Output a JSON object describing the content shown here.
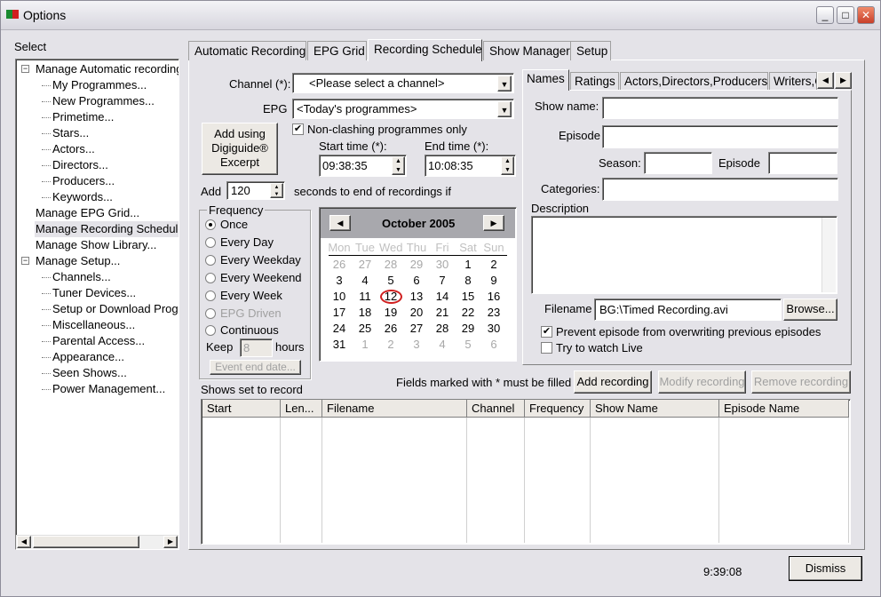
{
  "window": {
    "title": "Options",
    "icon": "app-icon",
    "buttons": [
      "minimize",
      "maximize",
      "close"
    ]
  },
  "sidebar": {
    "label": "Select",
    "items": [
      {
        "label": "Manage Automatic recording",
        "level": 0,
        "expander": "minus"
      },
      {
        "label": "My Programmes...",
        "level": 1
      },
      {
        "label": "New Programmes...",
        "level": 1
      },
      {
        "label": "Primetime...",
        "level": 1
      },
      {
        "label": "Stars...",
        "level": 1
      },
      {
        "label": "Actors...",
        "level": 1
      },
      {
        "label": "Directors...",
        "level": 1
      },
      {
        "label": "Producers...",
        "level": 1
      },
      {
        "label": "Keywords...",
        "level": 1
      },
      {
        "label": "Manage EPG Grid...",
        "level": 0
      },
      {
        "label": "Manage Recording Schedule",
        "level": 0,
        "selected": true
      },
      {
        "label": "Manage Show Library...",
        "level": 0
      },
      {
        "label": "Manage Setup...",
        "level": 0,
        "expander": "minus"
      },
      {
        "label": "Channels...",
        "level": 1
      },
      {
        "label": "Tuner Devices...",
        "level": 1
      },
      {
        "label": "Setup or Download Program",
        "level": 1
      },
      {
        "label": "Miscellaneous...",
        "level": 1
      },
      {
        "label": "Parental Access...",
        "level": 1
      },
      {
        "label": "Appearance...",
        "level": 1
      },
      {
        "label": "Seen Shows...",
        "level": 1
      },
      {
        "label": "Power Management...",
        "level": 1
      }
    ]
  },
  "tabs": [
    {
      "label": "Automatic Recording"
    },
    {
      "label": "EPG Grid"
    },
    {
      "label": "Recording Schedule",
      "selected": true
    },
    {
      "label": "Show Manager"
    },
    {
      "label": "Setup"
    }
  ],
  "form": {
    "channel_label": "Channel (*):",
    "channel_value": "<Please select a channel>",
    "epg_label": "EPG",
    "epg_value": "<Today's programmes>",
    "digiguide_button": "Add using Digiguide® Excerpt",
    "nonclash_label": "Non-clashing programmes only",
    "nonclash_checked": true,
    "start_label": "Start time (*):",
    "start_value": "09:38:35",
    "end_label": "End time (*):",
    "end_value": "10:08:35",
    "add_label": "Add",
    "add_value": "120",
    "add_suffix": "seconds to end of recordings if",
    "frequency": {
      "label": "Frequency",
      "options": [
        {
          "label": "Once",
          "checked": true
        },
        {
          "label": "Every Day"
        },
        {
          "label": "Every Weekday"
        },
        {
          "label": "Every Weekend"
        },
        {
          "label": "Every Week"
        },
        {
          "label": "EPG Driven",
          "disabled": true
        },
        {
          "label": "Continuous"
        }
      ],
      "keep_label": "Keep",
      "keep_value": "8",
      "hours_label": "hours",
      "event_end_button": "Event end date..."
    }
  },
  "calendar": {
    "month": "October 2005",
    "weekdays": [
      "Mon",
      "Tue",
      "Wed",
      "Thu",
      "Fri",
      "Sat",
      "Sun"
    ],
    "weeks": [
      [
        "26",
        "27",
        "28",
        "29",
        "30",
        "1",
        "2"
      ],
      [
        "3",
        "4",
        "5",
        "6",
        "7",
        "8",
        "9"
      ],
      [
        "10",
        "11",
        "12",
        "13",
        "14",
        "15",
        "16"
      ],
      [
        "17",
        "18",
        "19",
        "20",
        "21",
        "22",
        "23"
      ],
      [
        "24",
        "25",
        "26",
        "27",
        "28",
        "29",
        "30"
      ],
      [
        "31",
        "1",
        "2",
        "3",
        "4",
        "5",
        "6"
      ]
    ],
    "today": "12",
    "circle_color": "#d02020"
  },
  "names": {
    "tabs": [
      {
        "label": "Names",
        "selected": true
      },
      {
        "label": "Ratings"
      },
      {
        "label": "Actors,Directors,Producers"
      },
      {
        "label": "Writers,C"
      }
    ],
    "show_name_label": "Show name:",
    "show_name_value": "",
    "episode_label": "Episode",
    "episode_value": "",
    "season_label": "Season:",
    "season_value": "",
    "episode2_label": "Episode",
    "episode2_value": "",
    "categories_label": "Categories:",
    "categories_value": "",
    "description_label": "Description",
    "description_value": "",
    "filename_label": "Filename",
    "filename_value": "BG:\\Timed Recording.avi",
    "browse_button": "Browse...",
    "prevent_label": "Prevent episode from overwriting previous episodes",
    "prevent_checked": true,
    "live_label": "Try to watch Live",
    "live_checked": false
  },
  "actions": {
    "fields_note": "Fields marked with * must be filled",
    "add": "Add recording",
    "modify": "Modify recording",
    "remove": "Remove recording"
  },
  "table": {
    "label": "Shows set to record",
    "columns": [
      "Start",
      "Len...",
      "Filename",
      "Channel",
      "Frequency",
      "Show Name",
      "Episode Name"
    ],
    "rows": []
  },
  "footer": {
    "time": "9:39:08",
    "dismiss": "Dismiss"
  }
}
